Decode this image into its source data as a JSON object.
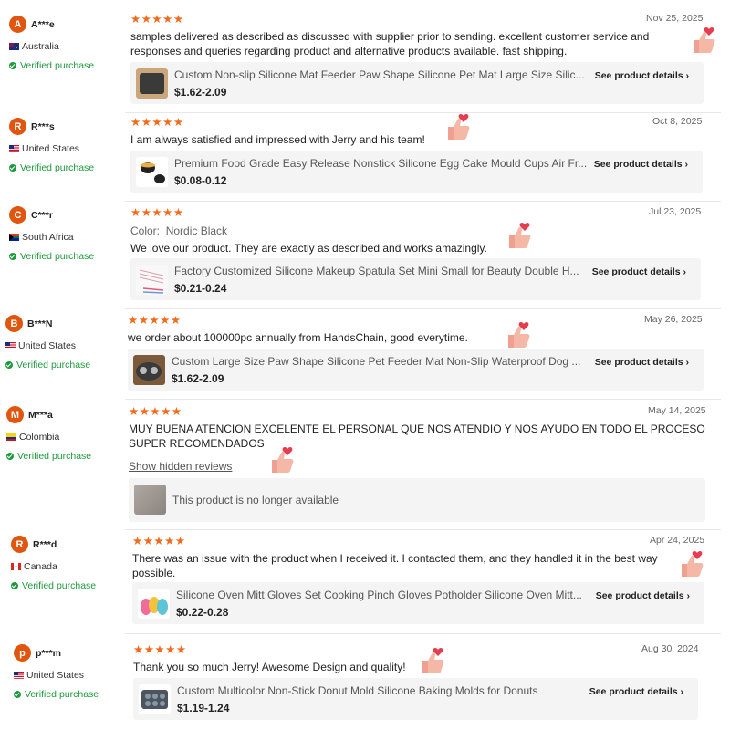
{
  "reviews": [
    {
      "initial": "A",
      "name": "A***e",
      "country": "Australia",
      "verified": "Verified purchase",
      "date": "Nov 25, 2025",
      "text": "samples delivered as described as discussed with supplier prior to sending.  excellent customer service and responses and queries regarding product and alternative products available.  fast shipping.",
      "product_title": "Custom Non-slip Silicone Mat Feeder Paw Shape Silicone Pet Mat Large Size Silic...",
      "price": "$1.62-2.09",
      "see_details": "See product details"
    },
    {
      "initial": "R",
      "name": "R***s",
      "country": "United States",
      "verified": "Verified purchase",
      "date": "Oct 8, 2025",
      "text": "I am always satisfied and impressed with Jerry and his team!",
      "product_title": "Premium Food Grade Easy Release Nonstick Silicone Egg Cake Mould Cups Air Fr...",
      "price": "$0.08-0.12",
      "see_details": "See product details"
    },
    {
      "initial": "C",
      "name": "C***r",
      "country": "South Africa",
      "verified": "Verified purchase",
      "date": "Jul 23, 2025",
      "color_label": "Color:",
      "color_value": "Nordic Black",
      "text": "We love our product. They are exactly as described and works amazingly.",
      "product_title": "Factory Customized Silicone Makeup Spatula Set Mini Small for Beauty Double H...",
      "price": "$0.21-0.24",
      "see_details": "See product details"
    },
    {
      "initial": "B",
      "name": "B***N",
      "country": "United States",
      "verified": "Verified purchase",
      "date": "May 26, 2025",
      "text": "we order about 100000pc annually from HandsChain, good everytime.",
      "product_title": "Custom Large Size Paw Shape Silicone Pet Feeder Mat Non-Slip Waterproof Dog ...",
      "price": "$1.62-2.09",
      "see_details": "See product details"
    },
    {
      "initial": "M",
      "name": "M***a",
      "country": "Colombia",
      "verified": "Verified purchase",
      "date": "May 14, 2025",
      "text": "MUY BUENA ATENCION EXCELENTE EL PERSONAL QUE NOS ATENDIO Y NOS AYUDO EN TODO EL PROCESO SUPER RECOMENDADOS",
      "hidden_link": "Show hidden reviews",
      "unavailable": "This product is no longer available"
    },
    {
      "initial": "R",
      "name": "R***d",
      "country": "Canada",
      "verified": "Verified purchase",
      "date": "Apr 24, 2025",
      "text": "There was an issue with the product when I received it. I contacted them, and they handled it in the best way possible.",
      "product_title": "Silicone Oven Mitt Gloves Set Cooking Pinch Gloves Potholder Silicone Oven Mitt...",
      "price": "$0.22-0.28",
      "see_details": "See product details"
    },
    {
      "initial": "p",
      "name": "p***m",
      "country": "United States",
      "verified": "Verified purchase",
      "date": "Aug 30, 2024",
      "text": "Thank you so much Jerry! Awesome Design and quality!",
      "product_title": "Custom Multicolor Non-Stick Donut Mold Silicone Baking Molds for Donuts",
      "price": "$1.19-1.24",
      "see_details": "See product details"
    }
  ],
  "stars": "★★★★★",
  "colors": {
    "accent": "#f26b1d",
    "avatar": "#e0560f",
    "verified": "#1f9a3e"
  }
}
